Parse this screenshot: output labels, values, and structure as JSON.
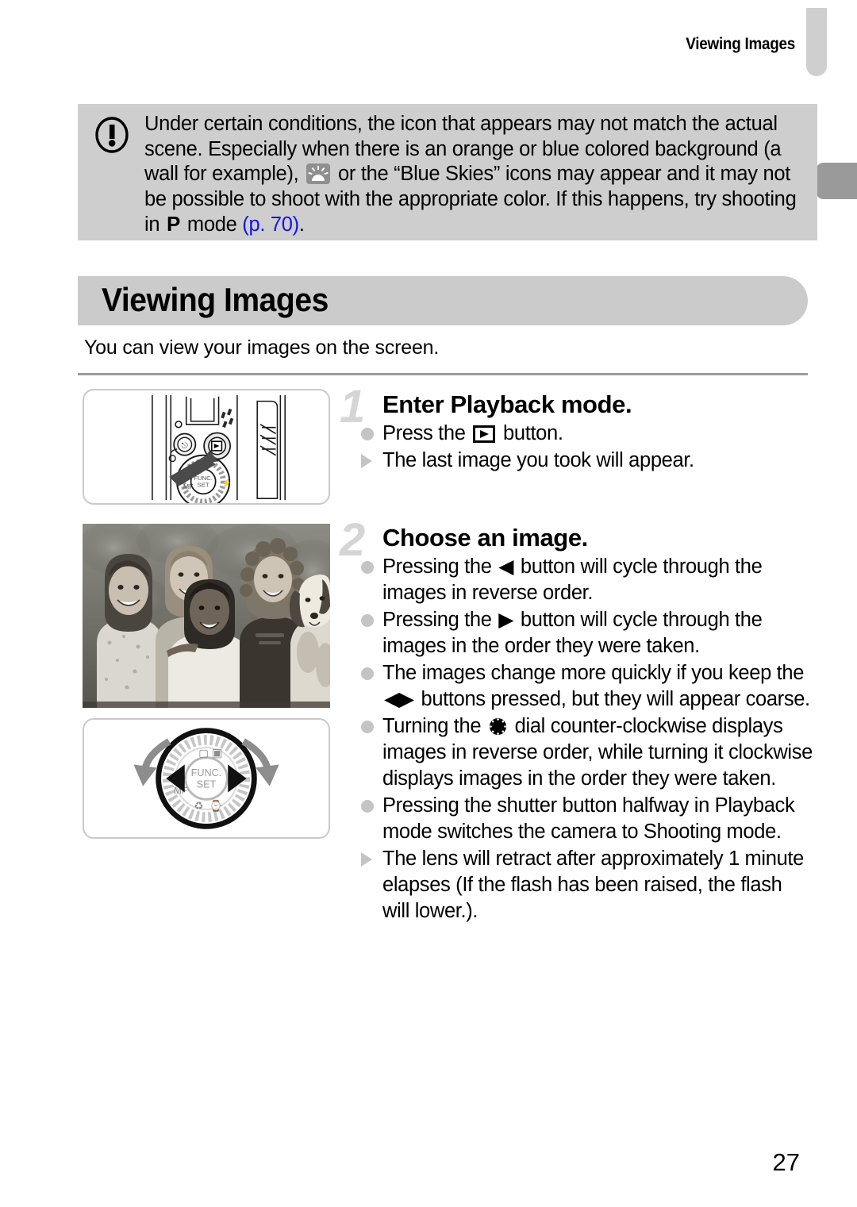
{
  "header": {
    "running_title": "Viewing Images"
  },
  "caution": {
    "icon": "exclamation-circle-icon",
    "text_part1": "Under certain conditions, the icon that appears may not match the actual scene. Especially when there is an orange or blue colored background (a wall for example), ",
    "inline_icon_1": "blue-skies-icon",
    "text_part2": " or the “Blue Skies” icons may appear and it may not be possible to shoot with the appropriate color. If this happens, try shooting in ",
    "mode_letter": "P",
    "text_part3": " mode ",
    "page_ref": "(p. 70)",
    "text_part4": ".",
    "link_color": "#1414e6",
    "background_color": "#cecece"
  },
  "section": {
    "title": "Viewing Images",
    "intro": "You can view your images on the screen.",
    "banner_color": "#cbcbcb"
  },
  "figures": {
    "camera_back": {
      "caption": "camera-back-playback-button-illustration"
    },
    "sample_photo": {
      "caption": "sample-photo-four-children-with-dog"
    },
    "control_dial": {
      "caption": "control-dial-rotation-illustration",
      "center_label_line1": "FUNC.",
      "center_label_line2": "SET",
      "label_mf": "MF"
    }
  },
  "steps": [
    {
      "number": "1",
      "title": "Enter Playback mode.",
      "bullets": [
        {
          "marker": "dot",
          "segments": [
            {
              "type": "text",
              "value": "Press the "
            },
            {
              "type": "icon",
              "value": "playback-button-icon"
            },
            {
              "type": "text",
              "value": " button."
            }
          ]
        },
        {
          "marker": "triangle",
          "segments": [
            {
              "type": "text",
              "value": "The last image you took will appear."
            }
          ]
        }
      ]
    },
    {
      "number": "2",
      "title": "Choose an image.",
      "bullets": [
        {
          "marker": "dot",
          "segments": [
            {
              "type": "text",
              "value": "Pressing the "
            },
            {
              "type": "glyph",
              "value": "◀"
            },
            {
              "type": "text",
              "value": " button will cycle through the images in reverse order."
            }
          ]
        },
        {
          "marker": "dot",
          "segments": [
            {
              "type": "text",
              "value": "Pressing the "
            },
            {
              "type": "glyph",
              "value": "▶"
            },
            {
              "type": "text",
              "value": " button will cycle through the images in the order they were taken."
            }
          ]
        },
        {
          "marker": "dot",
          "segments": [
            {
              "type": "text",
              "value": "The images change more quickly if you keep the "
            },
            {
              "type": "glyph",
              "value": "◀▶"
            },
            {
              "type": "text",
              "value": " buttons pressed, but they will appear coarse."
            }
          ]
        },
        {
          "marker": "dot",
          "segments": [
            {
              "type": "text",
              "value": "Turning the "
            },
            {
              "type": "icon",
              "value": "control-dial-icon"
            },
            {
              "type": "text",
              "value": " dial counter-clockwise displays images in reverse order, while turning it clockwise displays images in the order they were taken."
            }
          ]
        },
        {
          "marker": "dot",
          "segments": [
            {
              "type": "text",
              "value": "Pressing the shutter button halfway in Playback mode switches the camera to Shooting mode."
            }
          ]
        },
        {
          "marker": "triangle",
          "segments": [
            {
              "type": "text",
              "value": "The lens will retract after approximately 1 minute elapses (If the flash has been raised, the flash will lower.)."
            }
          ]
        }
      ]
    }
  ],
  "footer": {
    "page_number": "27"
  }
}
